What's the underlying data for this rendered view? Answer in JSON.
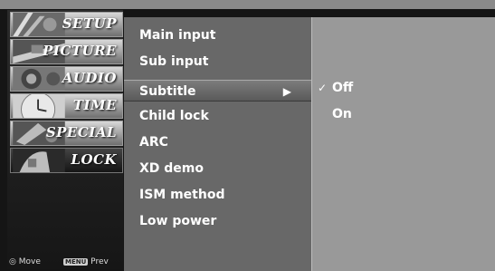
{
  "categories": [
    {
      "label": "SETUP"
    },
    {
      "label": "PICTURE"
    },
    {
      "label": "AUDIO"
    },
    {
      "label": "TIME"
    },
    {
      "label": "SPECIAL"
    },
    {
      "label": "LOCK"
    }
  ],
  "hints": {
    "move_label": "Move",
    "menu_key": "MENU",
    "prev_label": "Prev"
  },
  "menu": {
    "items": [
      {
        "label": "Main input"
      },
      {
        "label": "Sub input"
      },
      {
        "label": "Subtitle",
        "arrow": "▶"
      },
      {
        "label": "Child lock"
      },
      {
        "label": "ARC"
      },
      {
        "label": "XD demo"
      },
      {
        "label": "ISM method"
      },
      {
        "label": "Low power"
      }
    ]
  },
  "submenu": {
    "options": [
      {
        "label": "Off",
        "check": "✓"
      },
      {
        "label": "On"
      }
    ]
  },
  "colors": {
    "menu_panel": "#686868",
    "sub_panel": "#999999",
    "background": "#151515"
  }
}
